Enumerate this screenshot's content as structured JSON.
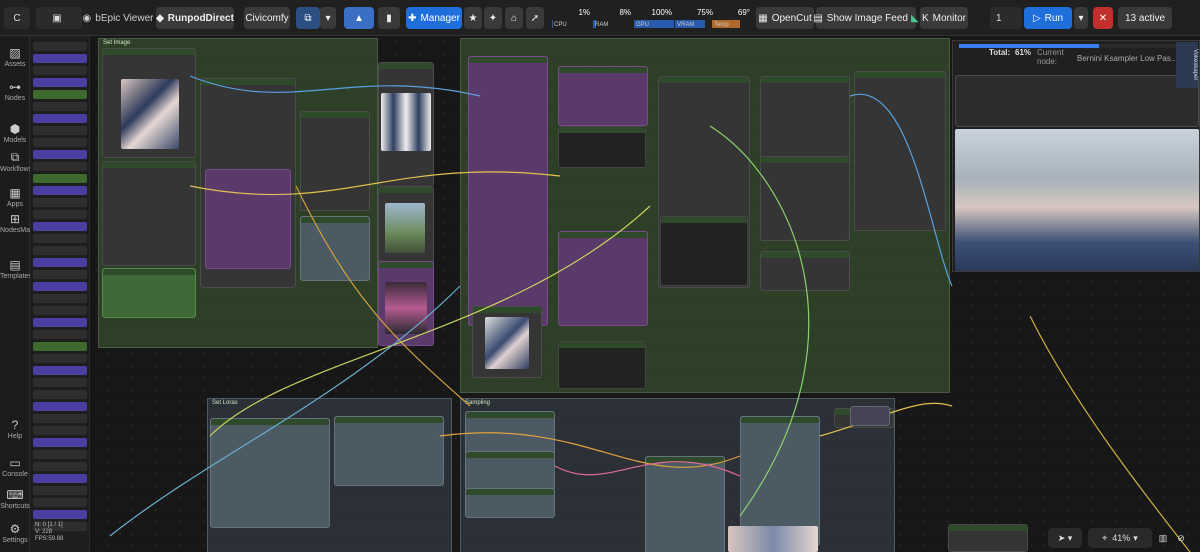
{
  "topbar": {
    "tab_viewer": "bEpic Viewer",
    "tab_runpod": "RunpodDirect",
    "tab_civicomfy": "Civicomfy",
    "manager": "Manager",
    "cpu_label": "CPU",
    "cpu_value": "1%",
    "cpu_fill": 1,
    "ram_label": "RAM",
    "ram_value": "8%",
    "ram_fill": 8,
    "gpu_label": "GPU",
    "gpu_value": "100%",
    "gpu_fill": 100,
    "vram_label": "VRAM",
    "vram_value": "75%",
    "vram_fill": 75,
    "temp_label": "Temp",
    "temp_value": "69°",
    "temp_fill": 69,
    "opencut": "OpenCut",
    "show_feed": "Show Image Feed",
    "monitor": "Monitor",
    "batch_count": "1",
    "run": "Run",
    "active": "13 active"
  },
  "sidebar": {
    "items": [
      {
        "label": "Assets",
        "icon": "image-icon"
      },
      {
        "label": "Nodes",
        "icon": "nodes-icon"
      },
      {
        "label": "Models",
        "icon": "cube-icon"
      },
      {
        "label": "Workflows",
        "icon": "workflow-icon"
      },
      {
        "label": "Apps",
        "icon": "apps-icon"
      },
      {
        "label": "NodesMap",
        "icon": "map-icon"
      },
      {
        "label": "Templates",
        "icon": "template-icon"
      },
      {
        "label": "Help",
        "icon": "help-icon"
      },
      {
        "label": "Console",
        "icon": "console-icon"
      },
      {
        "label": "Shortcuts",
        "icon": "keyboard-icon"
      },
      {
        "label": "Settings",
        "icon": "gear-icon"
      }
    ]
  },
  "stats": {
    "n": "N: 0 [1 / 1]",
    "v": "V: 228",
    "fps": "FPS:59.88"
  },
  "canvas": {
    "group_left": "Set Image",
    "group_sampling": "Sampling",
    "group_loras": "Set Loras"
  },
  "preview": {
    "total_label": "Total:",
    "total_value": "61%",
    "total_fill": 61,
    "current_label": "Current node:",
    "current_value": "Bernini Ksampler Low Pas..."
  },
  "side_badge": "Vokeskaper",
  "zoom": "41%",
  "colors": {
    "accent": "#1e6fd9",
    "group_green": "#3f6234",
    "danger": "#c2302e"
  }
}
